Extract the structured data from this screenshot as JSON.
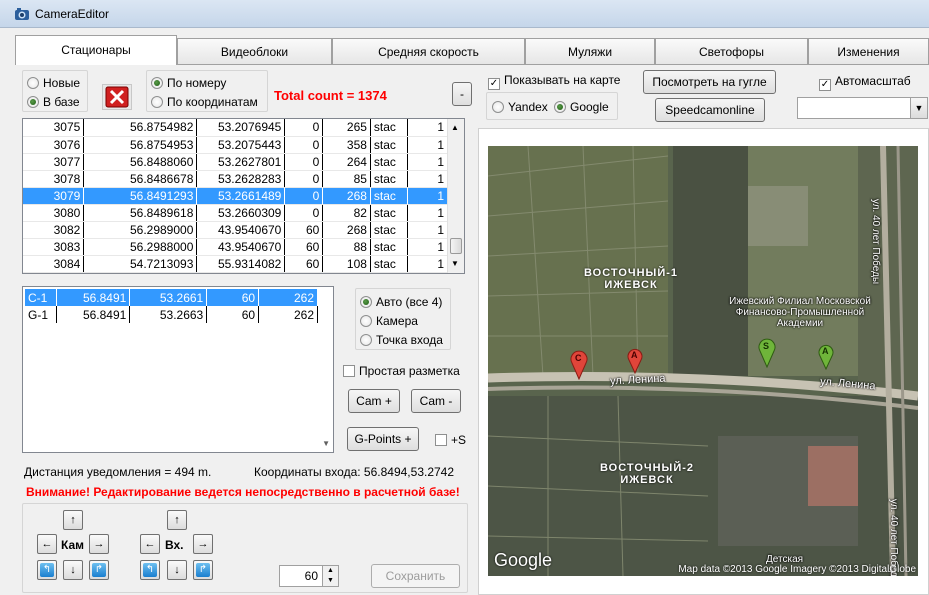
{
  "window": {
    "title": "CameraEditor"
  },
  "tabs": [
    "Стационары",
    "Видеоблоки",
    "Средняя скорость",
    "Муляжи",
    "Светофоры",
    "Изменения"
  ],
  "filter": {
    "source_new": "Новые",
    "source_db": "В базе",
    "sort_number": "По номеру",
    "sort_coords": "По координатам",
    "total_count": "Total count = 1374",
    "minus_label": "-"
  },
  "map_options": {
    "show_on_map": "Показывать на карте",
    "view_google_btn": "Посмотреть на гугле",
    "autoscale": "Автомасштаб",
    "yandex": "Yandex",
    "google": "Google",
    "speedcam_btn": "Speedcamonline",
    "dropdown_value": ""
  },
  "stations": [
    [
      "3075",
      "56.8754982",
      "53.2076945",
      "0",
      "265",
      "stac",
      "1"
    ],
    [
      "3076",
      "56.8754953",
      "53.2075443",
      "0",
      "358",
      "stac",
      "1"
    ],
    [
      "3077",
      "56.8488060",
      "53.2627801",
      "0",
      "264",
      "stac",
      "1"
    ],
    [
      "3078",
      "56.8486678",
      "53.2628283",
      "0",
      "85",
      "stac",
      "1"
    ],
    [
      "3079",
      "56.8491293",
      "53.2661489",
      "0",
      "268",
      "stac",
      "1"
    ],
    [
      "3080",
      "56.8489618",
      "53.2660309",
      "0",
      "82",
      "stac",
      "1"
    ],
    [
      "3082",
      "56.2989000",
      "43.9540670",
      "60",
      "268",
      "stac",
      "1"
    ],
    [
      "3083",
      "56.2988000",
      "43.9540670",
      "60",
      "88",
      "stac",
      "1"
    ],
    [
      "3084",
      "54.7213093",
      "55.9314082",
      "60",
      "108",
      "stac",
      "1"
    ]
  ],
  "points": [
    [
      "C-1",
      "56.8491",
      "53.2661",
      "60",
      "262"
    ],
    [
      "G-1",
      "56.8491",
      "53.2663",
      "60",
      "262"
    ]
  ],
  "point_type": {
    "auto": "Авто (все 4)",
    "camera": "Камера",
    "entry": "Точка входа"
  },
  "simple_markup": "Простая разметка",
  "cam_plus": "Cam +",
  "cam_minus": "Cam -",
  "gpoints_plus": "G-Points +",
  "plus_s": "+S",
  "distance": "Дистанция уведомления = 494 m.",
  "entry_coords": "Координаты входа: 56.8494,53.2742",
  "warning": "Внимание! Редактирование ведется непосредственно в расчетной базе!",
  "nav": {
    "cam_label": "Кам",
    "entry_label": "Вх."
  },
  "speed_value": "60",
  "save_btn": "Сохранить",
  "map": {
    "district1": "ВОСТОЧНЫЙ-1\nИЖЕВСК",
    "district2": "ВОСТОЧНЫЙ-2\nИЖЕВСК",
    "academy": "Ижевский Филиал Московской\nФинансово-Промышленной\nАкадемии",
    "street1": "ул. Ленина",
    "street2": "ул. Ленина",
    "street_v1": "ул. 40 лет Победы",
    "street_v2": "ул. 40 лет Победы",
    "school": "Детская",
    "google_logo": "Google",
    "copyright": "Map data ©2013 Google Imagery ©2013 DigitalGlobe",
    "marker_c": "C",
    "marker_a1": "A",
    "marker_s": "S",
    "marker_a2": "A"
  },
  "colors": {
    "selection": "#3399ff",
    "warning": "#ff0000",
    "marker_red": "#e0453a",
    "marker_green": "#6fb53a"
  }
}
